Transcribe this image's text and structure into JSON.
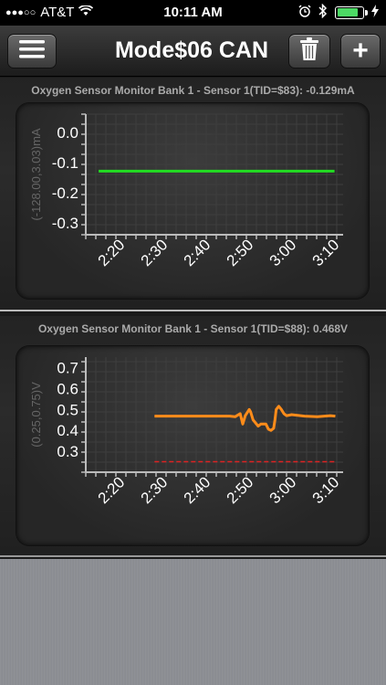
{
  "status_bar": {
    "carrier": "AT&T",
    "time": "10:11 AM",
    "signal_dots": "●●●○○",
    "wifi_icon": "wifi-icon",
    "alarm_icon": "alarm-icon",
    "bluetooth_icon": "bluetooth-icon",
    "battery_level": 0.85
  },
  "nav": {
    "title": "Mode$06 CAN",
    "add_label": "+",
    "menu_icon": "hamburger-icon",
    "trash_icon": "trash-icon"
  },
  "charts": [
    {
      "panel_title": "Oxygen Sensor Monitor Bank 1 - Sensor 1(TID=$83): -0.129mA",
      "ylabel": "(-128.00,3.03)mA",
      "y_ticks": [
        "0.0",
        "-0.1",
        "-0.2",
        "-0.3"
      ],
      "x_ticks": [
        "2:20",
        "2:30",
        "2:40",
        "2:50",
        "3:00",
        "3:10"
      ]
    },
    {
      "panel_title": "Oxygen Sensor Monitor Bank 1 - Sensor 1(TID=$88): 0.468V",
      "ylabel": "(0.25,0.75)V",
      "y_ticks": [
        "0.7",
        "0.6",
        "0.5",
        "0.4",
        "0.3"
      ],
      "x_ticks": [
        "2:20",
        "2:30",
        "2:40",
        "2:50",
        "3:00",
        "3:10"
      ]
    }
  ],
  "chart_data": [
    {
      "type": "line",
      "title": "Oxygen Sensor Monitor Bank 1 - Sensor 1(TID=$83): -0.129mA",
      "ylabel": "(-128.00,3.03)mA",
      "xlabel": "",
      "x_ticks": [
        "2:20",
        "2:30",
        "2:40",
        "2:50",
        "3:00",
        "3:10"
      ],
      "ylim": [
        -0.34,
        0.06
      ],
      "series": [
        {
          "color": "#22dd22",
          "x": [
            "2:15",
            "3:10"
          ],
          "values": [
            -0.129,
            -0.129
          ]
        }
      ]
    },
    {
      "type": "line",
      "title": "Oxygen Sensor Monitor Bank 1 - Sensor 1(TID=$88): 0.468V",
      "ylabel": "(0.25,0.75)V",
      "xlabel": "",
      "x_ticks": [
        "2:20",
        "2:30",
        "2:40",
        "2:50",
        "3:00",
        "3:10"
      ],
      "ylim": [
        0.2,
        0.75
      ],
      "series": [
        {
          "color": "#ff8c1a",
          "x": [
            2.467,
            2.76,
            2.78,
            2.8,
            2.81,
            2.82,
            2.83,
            2.835,
            2.84,
            2.85,
            2.87,
            2.88,
            2.9,
            2.91,
            2.92,
            2.93,
            2.935,
            2.94,
            2.95,
            2.96,
            2.97,
            2.98,
            3.0,
            3.05,
            3.1,
            3.15,
            3.17
          ],
          "values": [
            0.468,
            0.468,
            0.465,
            0.48,
            0.43,
            0.47,
            0.49,
            0.5,
            0.49,
            0.45,
            0.42,
            0.43,
            0.43,
            0.405,
            0.4,
            0.41,
            0.45,
            0.5,
            0.515,
            0.5,
            0.48,
            0.47,
            0.475,
            0.468,
            0.465,
            0.47,
            0.468
          ]
        },
        {
          "color": "#dd2222",
          "dashed": true,
          "x": [
            2.467,
            3.17
          ],
          "values": [
            0.25,
            0.25
          ]
        }
      ]
    }
  ]
}
